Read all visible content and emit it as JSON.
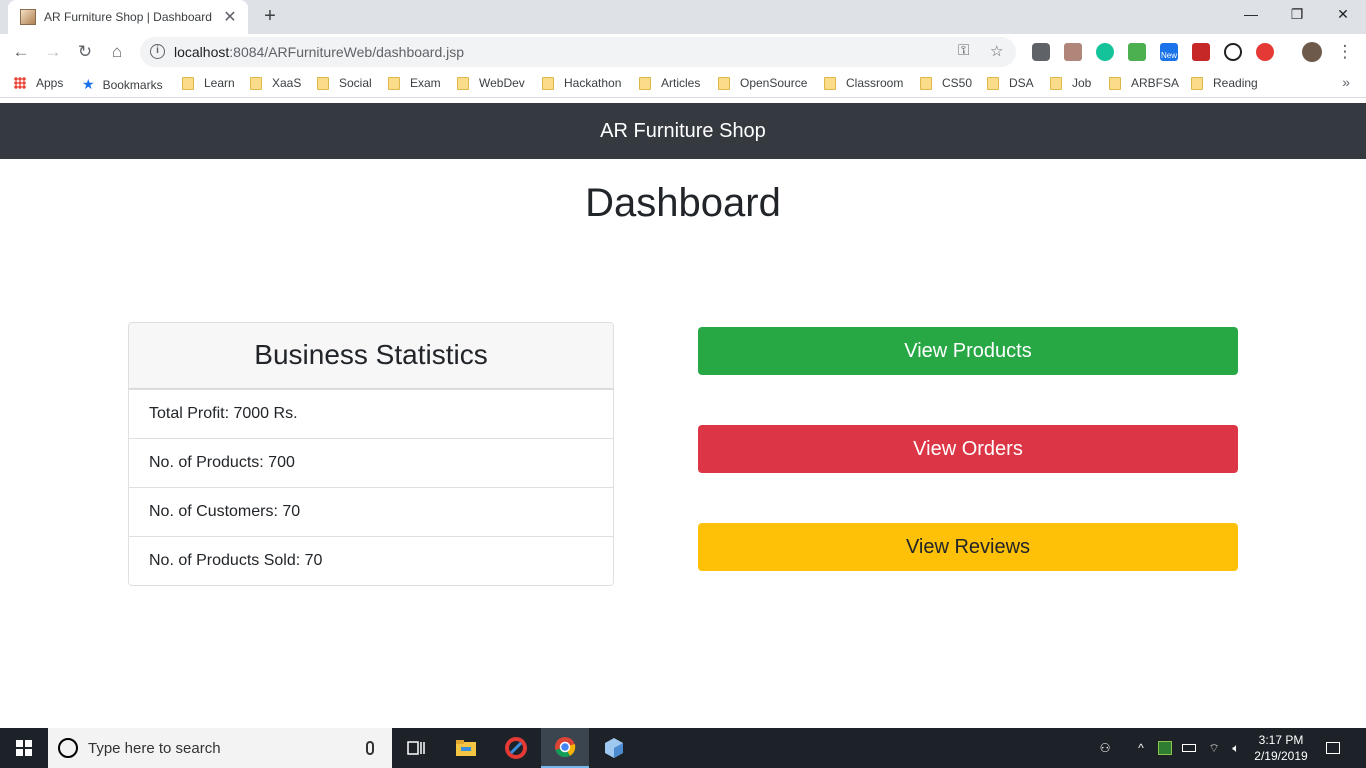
{
  "browser": {
    "tab_title": "AR Furniture Shop | Dashboard",
    "url_host": "localhost",
    "url_rest": ":8084/ARFurnitureWeb/dashboard.jsp"
  },
  "bookmarks": {
    "apps": "Apps",
    "bookmarks": "Bookmarks",
    "folders": [
      "Learn",
      "XaaS",
      "Social",
      "Exam",
      "WebDev",
      "Hackathon",
      "Articles",
      "OpenSource",
      "Classroom",
      "CS50",
      "DSA",
      "Job",
      "ARBFSA",
      "Reading"
    ]
  },
  "site": {
    "brand": "AR Furniture Shop",
    "page_title": "Dashboard"
  },
  "stats": {
    "header": "Business Statistics",
    "items": [
      "Total Profit: 7000 Rs.",
      "No. of Products: 700",
      "No. of Customers: 70",
      "No. of Products Sold: 70"
    ]
  },
  "actions": {
    "products": "View Products",
    "orders": "View Orders",
    "reviews": "View Reviews"
  },
  "colors": {
    "navbar": "#343a40",
    "success": "#28a745",
    "danger": "#dc3545",
    "warning": "#ffc107"
  },
  "taskbar": {
    "search_placeholder": "Type here to search",
    "time": "3:17 PM",
    "date": "2/19/2019",
    "new_badge": "New"
  }
}
